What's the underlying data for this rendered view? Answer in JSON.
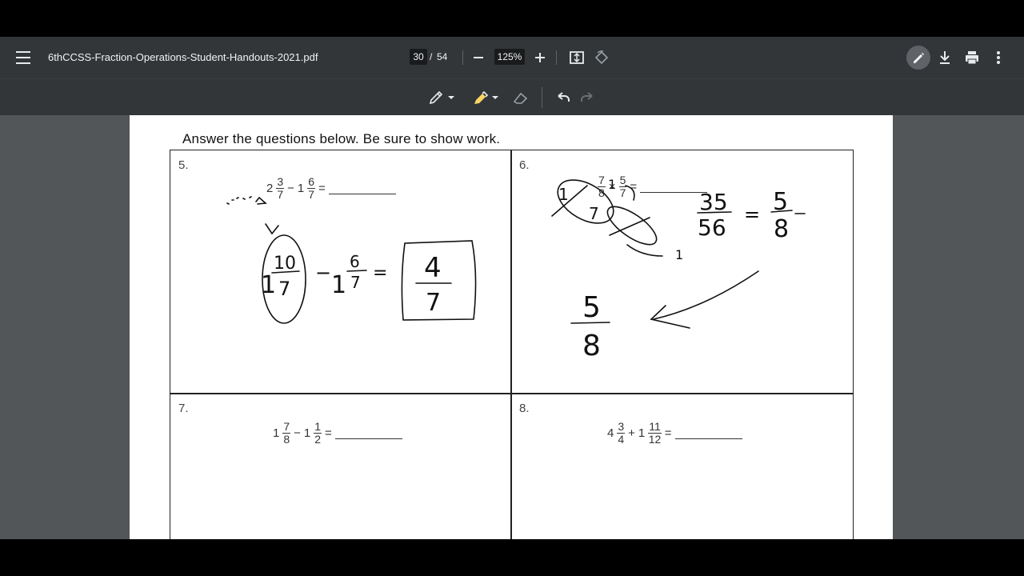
{
  "toolbar": {
    "filename": "6thCCSS-Fraction-Operations-Student-Handouts-2021.pdf",
    "current_page": "30",
    "page_sep": "/",
    "total_pages": "54",
    "zoom": "125%"
  },
  "document": {
    "instructions": "Answer the questions below.  Be sure to show work.",
    "q5": {
      "num": "5.",
      "whole1": "2",
      "n1": "3",
      "d1": "7",
      "op": "−",
      "whole2": "1",
      "n2": "6",
      "d2": "7",
      "eq": "="
    },
    "q6": {
      "num": "6.",
      "n1": "7",
      "d1": "8",
      "op": "×",
      "n2": "5",
      "d2": "7",
      "eq": "="
    },
    "q7": {
      "num": "7.",
      "whole1": "1",
      "n1": "7",
      "d1": "8",
      "op": "−",
      "whole2": "1",
      "n2": "1",
      "d2": "2",
      "eq": "="
    },
    "q8": {
      "num": "8.",
      "whole1": "4",
      "n1": "3",
      "d1": "4",
      "op": "+",
      "whole2": "1",
      "n2": "11",
      "d2": "12",
      "eq": "="
    }
  },
  "handwriting": {
    "q5_a": "1",
    "q5_b": "10",
    "q5_c": "7",
    "q5_d": "−",
    "q5_e": "1",
    "q5_f": "6",
    "q5_g": "7",
    "q5_h": "=",
    "q5_ans_n": "4",
    "q5_ans_d": "7",
    "q6_a": "1",
    "q6_b": "1",
    "q6_c": "7",
    "q6_r1n": "35",
    "q6_r1d": "56",
    "q6_eq": "=",
    "q6_r2n": "5",
    "q6_r2d": "8",
    "q6_fn": "5",
    "q6_fd": "8"
  }
}
